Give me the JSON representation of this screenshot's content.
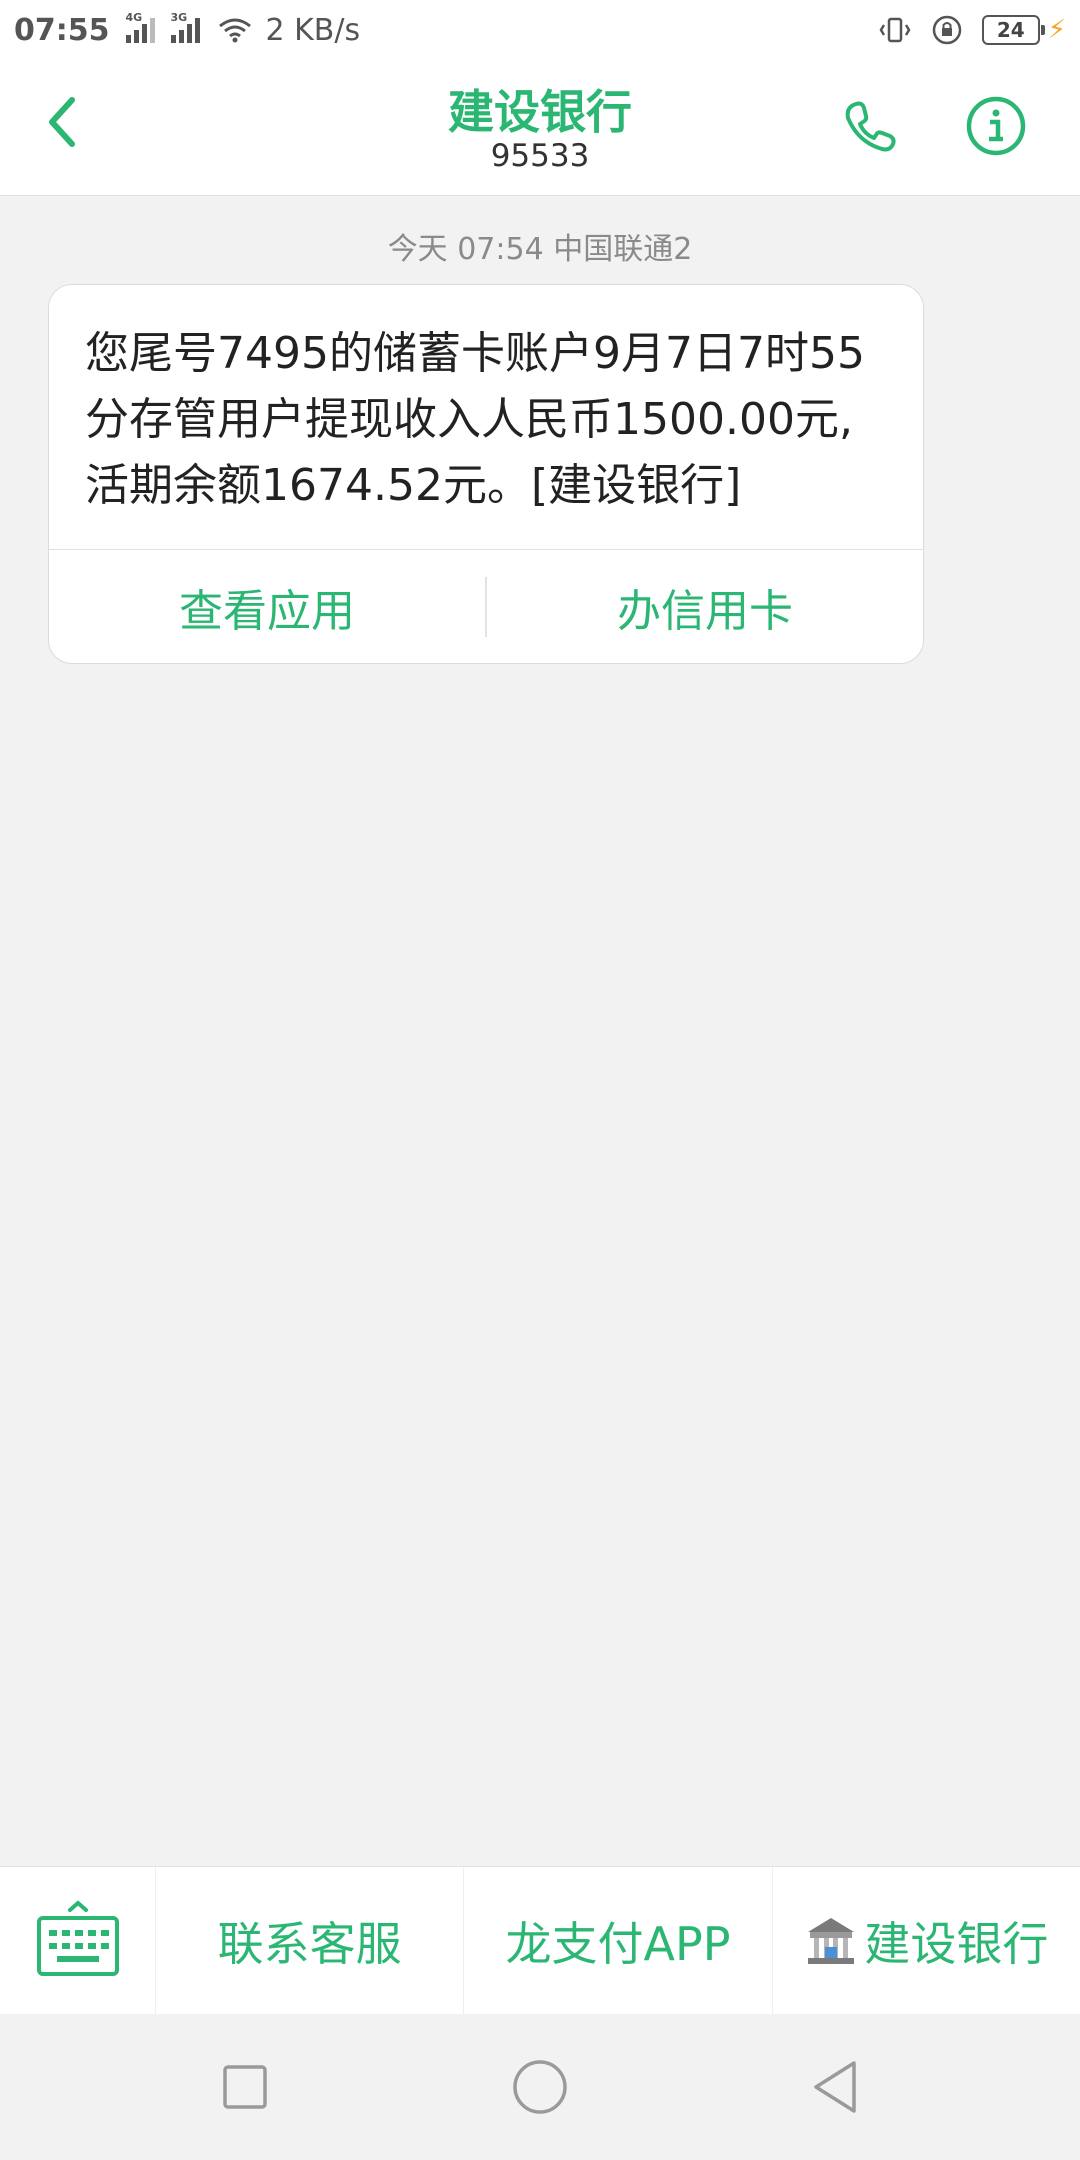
{
  "status_bar": {
    "time": "07:55",
    "signal1_tag": "4G",
    "signal2_tag": "3G",
    "speed": "2 KB/s",
    "battery_level": "24",
    "icons": [
      "vibrate-icon",
      "rotation-lock-icon",
      "battery-icon",
      "charging-icon"
    ]
  },
  "header": {
    "title": "建设银行",
    "number": "95533",
    "icons": [
      "back-arrow-icon",
      "phone-icon",
      "info-icon"
    ]
  },
  "conversation": {
    "timestamp": "今天 07:54  中国联通2",
    "message": "您尾号7495的储蓄卡账户9月7日7时55分存管用户提现收入人民币1500.00元,活期余额1674.52元。[建设银行]",
    "actions": [
      "查看应用",
      "办信用卡"
    ]
  },
  "bottom_menu": {
    "items": [
      "联系客服",
      "龙支付APP",
      "建设银行"
    ],
    "icons": [
      "keyboard-icon",
      "bank-icon"
    ]
  },
  "nav_bar": {
    "icons": [
      "recents-icon",
      "home-icon",
      "back-icon"
    ]
  },
  "colors": {
    "accent": "#2bb673",
    "background": "#f2f2f2"
  }
}
